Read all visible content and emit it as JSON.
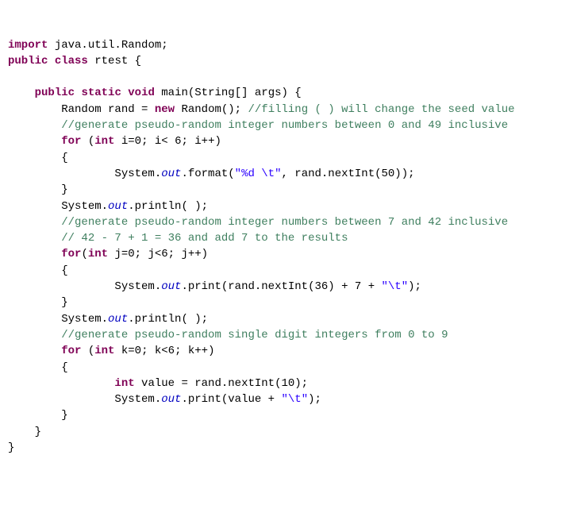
{
  "code": {
    "l1": {
      "kw1": "import",
      "pkg": " java.util.Random;"
    },
    "l2": {
      "kw1": "public",
      "kw2": "class",
      "name": " rtest ",
      "brace": "{"
    },
    "l3": "",
    "l4": {
      "kw1": "public",
      "kw2": "static",
      "kw3": "void",
      "sig": " main(String[] args) {"
    },
    "l5": {
      "t1": "Random rand = ",
      "kw": "new",
      "t2": " Random(); ",
      "com": "//filling ( ) will change the seed value"
    },
    "l6": {
      "com": "//generate pseudo-random integer numbers between 0 and 49 inclusive"
    },
    "l7": {
      "kw": "for",
      "t": " (",
      "kw2": "int",
      "t2": " i=0; i< 6; i++)"
    },
    "l8": "{",
    "l9": {
      "t1": "System.",
      "fld": "out",
      "t2": ".format(",
      "str": "\"%d \\t\"",
      "t3": ", rand.nextInt(50));"
    },
    "l10": "}",
    "l11": {
      "t1": "System.",
      "fld": "out",
      "t2": ".println( );"
    },
    "l12": {
      "com": "//generate pseudo-random integer numbers between 7 and 42 inclusive"
    },
    "l13": {
      "com": "// 42 - 7 + 1 = 36 and add 7 to the results"
    },
    "l14": {
      "kw": "for",
      "t": "(",
      "kw2": "int",
      "t2": " j=0; j<6; j++)"
    },
    "l15": "{",
    "l16": {
      "t1": "System.",
      "fld": "out",
      "t2": ".print(rand.nextInt(36) + 7 + ",
      "str": "\"\\t\"",
      "t3": ");"
    },
    "l17": "}",
    "l18": {
      "t1": "System.",
      "fld": "out",
      "t2": ".println( );"
    },
    "l19": {
      "com": "//generate pseudo-random single digit integers from 0 to 9"
    },
    "l20": {
      "kw": "for",
      "t": " (",
      "kw2": "int",
      "t2": " k=0; k<6; k++)"
    },
    "l21": "{",
    "l22": {
      "kw": "int",
      "t": " value = rand.nextInt(10);"
    },
    "l23": {
      "t1": "System.",
      "fld": "out",
      "t2": ".print(value + ",
      "str": "\"\\t\"",
      "t3": ");"
    },
    "l24": "}",
    "l25": "}",
    "l26": "}"
  },
  "indent": {
    "i0": "",
    "i1": "    ",
    "i2": "        ",
    "i3": "            ",
    "i4": "                "
  }
}
